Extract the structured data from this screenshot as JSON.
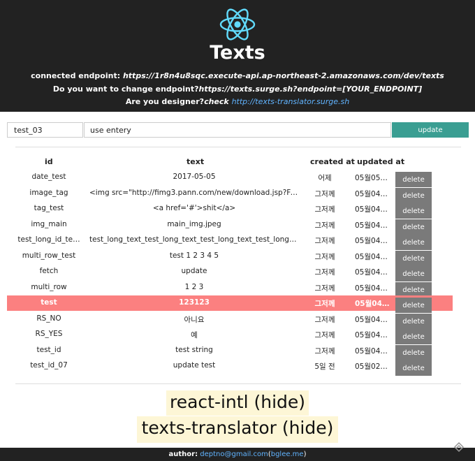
{
  "header": {
    "title": "Texts",
    "endpoint_label": "connected endpoint:",
    "endpoint_value": "https://1r8n4u8sqc.execute-api.ap-northeast-2.amazonaws.com/dev/texts",
    "change_label": "Do you want to change endpoint?",
    "change_value": "https://texts.surge.sh?endpoint=[YOUR_ENDPOINT]",
    "designer_label": "Are you designer?",
    "designer_check": "check",
    "designer_link": "http://texts-translator.surge.sh"
  },
  "form": {
    "id_value": "test_03",
    "text_value": "use entery",
    "update_label": "update"
  },
  "table": {
    "headers": {
      "id": "id",
      "text": "text",
      "created": "created at",
      "updated": "updated at"
    },
    "delete_label": "delete",
    "rows": [
      {
        "id": "date_test",
        "text": "2017-05-05",
        "created": "어제",
        "updated": "05월05…"
      },
      {
        "id": "image_tag",
        "text": "<img src=\"http://fimg3.pann.com/new/download.jsp?File…",
        "created": "그저께",
        "updated": "05월04…"
      },
      {
        "id": "tag_test",
        "text": "<a href='#'>shit</a>",
        "created": "그저께",
        "updated": "05월04…"
      },
      {
        "id": "img_main",
        "text": "main_img.jpeg",
        "created": "그저께",
        "updated": "05월04…"
      },
      {
        "id": "test_long_id_te…",
        "text": "test_long_text_test_long_text_test_long_text_test_long_tex…",
        "created": "그저께",
        "updated": "05월04…"
      },
      {
        "id": "multi_row_test",
        "text": "test 1 2 3 4 5",
        "created": "그저께",
        "updated": "05월04…"
      },
      {
        "id": "fetch",
        "text": "update",
        "created": "그저께",
        "updated": "05월04…"
      },
      {
        "id": "multi_row",
        "text": "1 2 3",
        "created": "그저께",
        "updated": "05월04…"
      },
      {
        "id": "test",
        "text": "123123",
        "created": "그저께",
        "updated": "05월04…"
      },
      {
        "id": "RS_NO",
        "text": "아니요",
        "created": "그저께",
        "updated": "05월04…"
      },
      {
        "id": "RS_YES",
        "text": "예",
        "created": "그저께",
        "updated": "05월04…"
      },
      {
        "id": "test_id",
        "text": "test string",
        "created": "그저께",
        "updated": "05월04…"
      },
      {
        "id": "test_id_07",
        "text": "update test",
        "created": "5일 전",
        "updated": "05월02…"
      }
    ]
  },
  "toggles": {
    "react_intl": "react-intl (hide)",
    "texts_translator": "texts-translator (hide)"
  },
  "footer": {
    "author_label": "author:",
    "email": "deptno@gmail.com",
    "open_paren": "(",
    "site": "bglee.me",
    "close_paren": ")"
  },
  "colors": {
    "header_bg": "#222222",
    "accent": "#3a9e92",
    "highlight_row": "#fb8080",
    "delete_button": "#7a7a7a",
    "link": "#61b4ff",
    "toggle_bg": "#fdf6d6"
  },
  "icons": {
    "logo": "react-logo-icon",
    "scroll_top": "scroll-top-icon"
  }
}
